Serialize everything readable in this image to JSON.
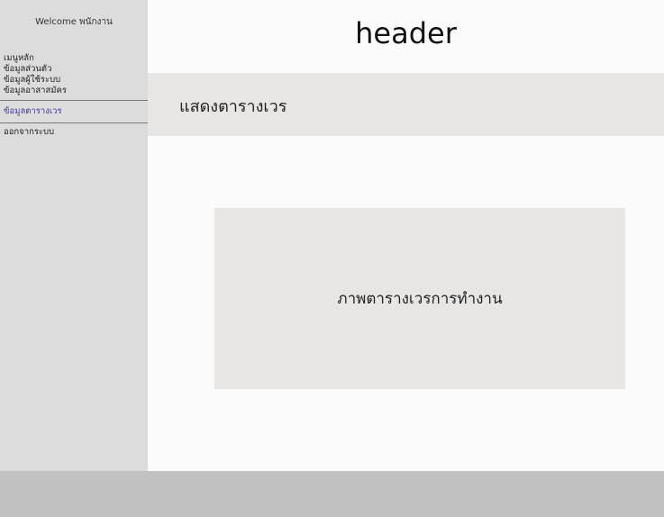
{
  "sidebar": {
    "welcome_text": "Welcome พนักงาน",
    "items": [
      {
        "label": "เมนูหลัก"
      },
      {
        "label": "ข้อมูลส่วนตัว"
      },
      {
        "label": "ข้อมูลผู้ใช้ระบบ"
      },
      {
        "label": "ข้อมูลอาสาสมัคร"
      },
      {
        "label": "ข้อมูลตารางเวร"
      },
      {
        "label": "ออกจากระบบ"
      }
    ]
  },
  "header": {
    "title": "header"
  },
  "page": {
    "title": "แสดงตารางเวร"
  },
  "content": {
    "image_label": "ภาพตารางเวรการทำงาน"
  },
  "colors": {
    "sidebar_bg": "#dddcdc",
    "active_item": "#3b3a9c",
    "footer_bg": "#c2c1c1"
  }
}
